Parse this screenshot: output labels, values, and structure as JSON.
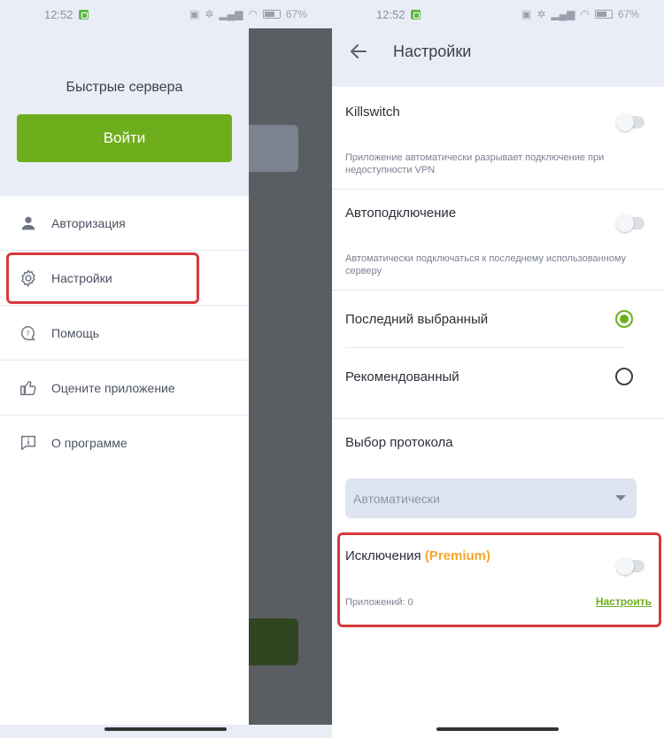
{
  "status_bar": {
    "time": "12:52",
    "battery_percent": "67",
    "battery_label": "67%"
  },
  "left": {
    "drawer_title": "Быстрые сервера",
    "login_button": "Войти",
    "menu": [
      {
        "label": "Авторизация",
        "icon": "user-icon"
      },
      {
        "label": "Настройки",
        "icon": "gear-icon"
      },
      {
        "label": "Помощь",
        "icon": "help-chat-icon"
      },
      {
        "label": "Оцените приложение",
        "icon": "thumbs-up-icon"
      },
      {
        "label": "О программе",
        "icon": "info-chat-icon"
      }
    ]
  },
  "right": {
    "title": "Настройки",
    "killswitch": {
      "title": "Killswitch",
      "desc": "Приложение автоматически разрывает подключение при недоступности VPN",
      "enabled": false
    },
    "autoconnect": {
      "title": "Автоподключение",
      "desc": "Автоматически подключаться к последнему использованному серверу",
      "enabled": false
    },
    "server_choice": {
      "last_selected": "Последний выбранный",
      "recommended": "Рекомендованный",
      "selected": "last_selected"
    },
    "protocol": {
      "title": "Выбор протокола",
      "selected": "Автоматически"
    },
    "exclusions": {
      "title": "Исключения",
      "premium": "(Premium)",
      "apps_count": "Приложений: 0",
      "configure": "Настроить",
      "enabled": false
    }
  },
  "colors": {
    "accent_green": "#6eae1c",
    "premium_orange": "#f3a72b",
    "highlight_red": "#d9393b",
    "header_bg": "#e9edf5"
  }
}
